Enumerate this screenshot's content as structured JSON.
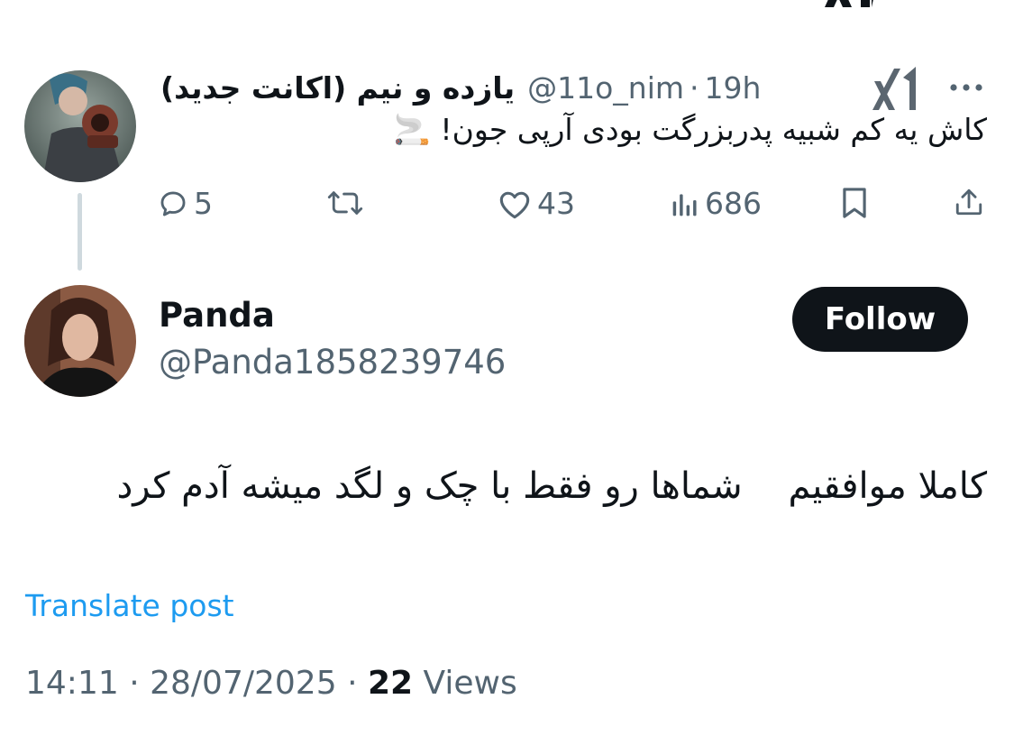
{
  "parent_tweet": {
    "display_name": "یازده و نیم (اکانت جدید)",
    "handle": "@11o_nim",
    "separator": "·",
    "time": "19h",
    "text": "کاش یه کم شبیه پدربزرگت بودی آرپی جون! 🚬",
    "avatar_icon": "user-avatar-with-gun",
    "badge_icon": "xai-logo",
    "stats": {
      "replies": "5",
      "retweets": "",
      "likes": "43",
      "views": "686"
    }
  },
  "reply": {
    "display_name": "Panda",
    "handle": "@Panda1858239746",
    "follow_label": "Follow",
    "text": "کاملا موافقیم    شماها رو فقط با چک و لگد میشه آدم کرد",
    "translate_label": "Translate post",
    "time": "14:11",
    "date": "28/07/2025",
    "separator": "·",
    "views_count": "22",
    "views_label": "Views"
  },
  "colors": {
    "text_primary": "#0f1419",
    "text_secondary": "#536471",
    "link": "#1d9bf0",
    "thread_line": "#cfd9de",
    "follow_bg": "#0f1419"
  }
}
